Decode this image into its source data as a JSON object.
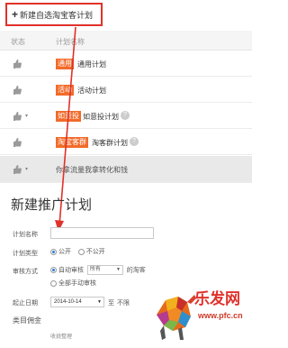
{
  "toolbar": {
    "new_plan_label": "新建自选淘宝客计划"
  },
  "table": {
    "headers": {
      "status": "状态",
      "plan_name": "计划名称"
    },
    "rows": [
      {
        "tag": "通用",
        "name": "通用计划",
        "help": false
      },
      {
        "tag": "活动",
        "name": "活动计划",
        "help": false
      },
      {
        "tag": "如意投",
        "name": "如意投计划",
        "help": true
      },
      {
        "tag": "淘宝客群",
        "name": "淘客群计划",
        "help": true
      },
      {
        "tag": "",
        "name": "你拿流量我拿转化和钱",
        "help": false
      }
    ]
  },
  "form": {
    "title": "新建推广计划",
    "plan_name_label": "计划名称",
    "plan_type_label": "计划类型",
    "type_public": "公开",
    "type_private": "不公开",
    "review_label": "审核方式",
    "review_auto": "自动审核",
    "review_select": "所有",
    "review_suffix": "的淘客",
    "review_manual": "全部手动审核",
    "start_date_label": "起止日期",
    "start_date": "2014-10-14",
    "date_to": "至",
    "date_unlimited": "不限",
    "category_label": "类目佣金",
    "collapse_label": "收拢整理"
  },
  "watermark": {
    "brand": "乐发网",
    "url": "www.pfc.cn"
  },
  "colors": {
    "highlight": "#e0312b",
    "tag": "#f26b2a"
  }
}
